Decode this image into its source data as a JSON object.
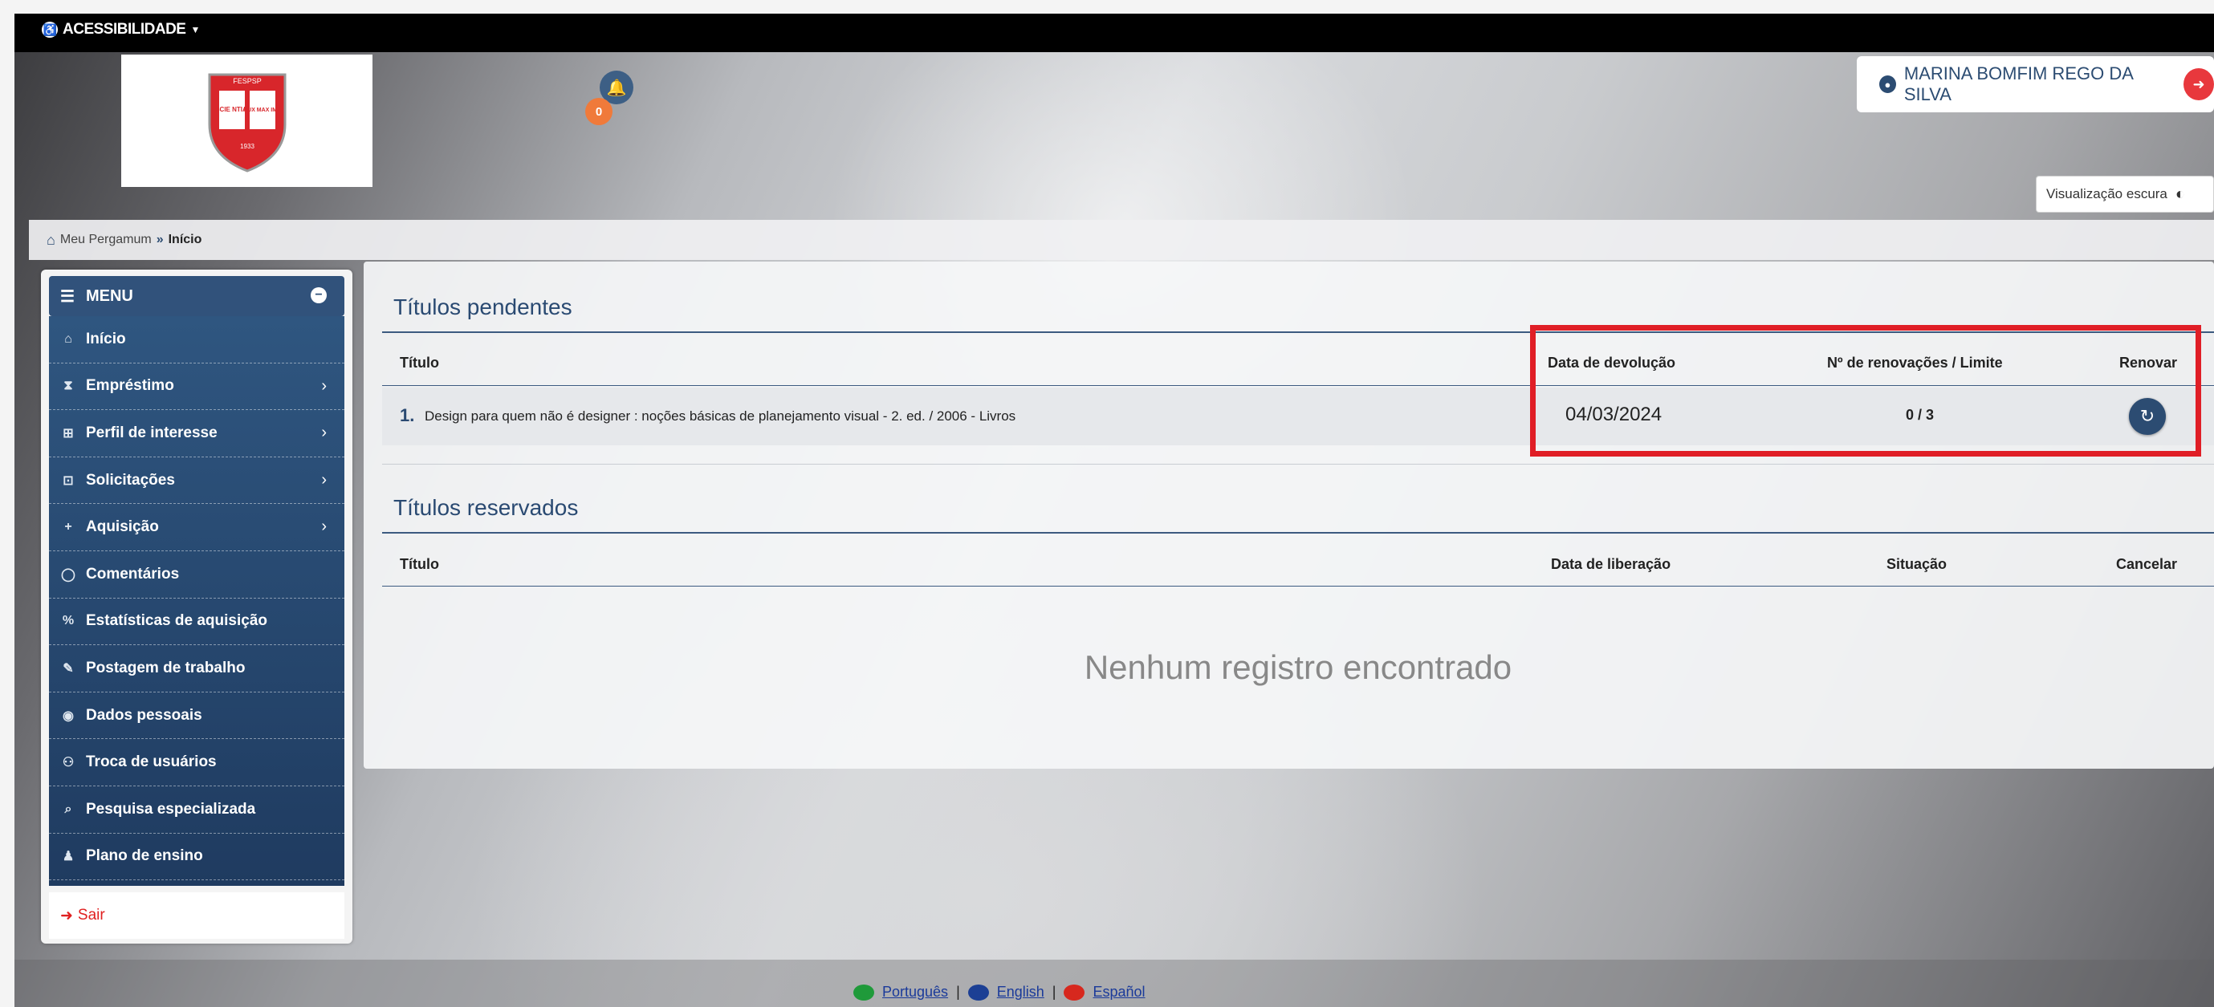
{
  "accessibility": {
    "label": "ACESSIBILIDADE"
  },
  "notifications": {
    "count": "0"
  },
  "user": {
    "name": "MARINA BOMFIM REGO DA SILVA"
  },
  "dark_mode": {
    "label": "Visualização escura"
  },
  "logo": {
    "top_text": "FESPSP",
    "left_text": "SCIE NTIA",
    "right_text": "LUX MAX IMA",
    "year": "1933"
  },
  "breadcrumb": {
    "root": "Meu Pergamum",
    "current": "Início"
  },
  "menu": {
    "title": "MENU",
    "items": [
      {
        "label": "Início",
        "icon": "home-icon",
        "sub": false
      },
      {
        "label": "Empréstimo",
        "icon": "hourglass-icon",
        "sub": true
      },
      {
        "label": "Perfil de interesse",
        "icon": "sitemap-icon",
        "sub": true
      },
      {
        "label": "Solicitações",
        "icon": "cart-icon",
        "sub": true
      },
      {
        "label": "Aquisição",
        "icon": "plus-icon",
        "sub": true
      },
      {
        "label": "Comentários",
        "icon": "comment-icon",
        "sub": false
      },
      {
        "label": "Estatísticas de aquisição",
        "icon": "percent-icon",
        "sub": false
      },
      {
        "label": "Postagem de trabalho",
        "icon": "edit-icon",
        "sub": false
      },
      {
        "label": "Dados pessoais",
        "icon": "user-circle-icon",
        "sub": false
      },
      {
        "label": "Troca de usuários",
        "icon": "users-icon",
        "sub": false
      },
      {
        "label": "Pesquisa especializada",
        "icon": "search-icon",
        "sub": false
      },
      {
        "label": "Plano de ensino",
        "icon": "teacher-icon",
        "sub": false
      }
    ],
    "exit": "Sair"
  },
  "pendentes": {
    "title": "Títulos pendentes",
    "headers": {
      "titulo": "Título",
      "data": "Data de devolução",
      "renovacoes": "Nº de renovações / Limite",
      "renovar": "Renovar"
    },
    "rows": [
      {
        "num": "1.",
        "titulo": "Design para quem não é designer : noções básicas de planejamento visual - 2. ed. / 2006 - Livros",
        "data": "04/03/2024",
        "renovacoes": "0 / 3"
      }
    ]
  },
  "reservados": {
    "title": "Títulos reservados",
    "headers": {
      "titulo": "Título",
      "data": "Data de liberação",
      "situacao": "Situação",
      "cancelar": "Cancelar"
    },
    "empty": "Nenhum registro encontrado"
  },
  "footer": {
    "languages": [
      "Português",
      "English",
      "Español"
    ],
    "separator": "|"
  },
  "colors": {
    "primary": "#2c4c72",
    "highlight_border": "#e01e26",
    "logout": "#e8383d",
    "badge": "#f07a3a"
  }
}
